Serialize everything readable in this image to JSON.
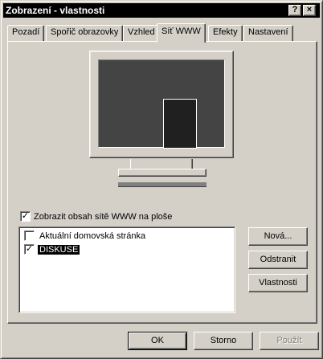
{
  "window": {
    "title": "Zobrazení - vlastnosti",
    "help_button": "?",
    "close_button": "×"
  },
  "tabs": [
    {
      "label": "Pozadí",
      "active": false
    },
    {
      "label": "Spořič obrazovky",
      "active": false
    },
    {
      "label": "Vzhled",
      "active": false
    },
    {
      "label": "Síť WWW",
      "active": true
    },
    {
      "label": "Efekty",
      "active": false
    },
    {
      "label": "Nastavení",
      "active": false
    }
  ],
  "web_tab": {
    "show_web_checkbox": {
      "label": "Zobrazit obsah sítě WWW na ploše",
      "checked": true,
      "mark": "✓"
    },
    "items": [
      {
        "label": "Aktuální domovská stránka",
        "checked": false,
        "mark": ""
      },
      {
        "label": "DISKUSE",
        "checked": true,
        "selected": true,
        "mark": "✓"
      }
    ],
    "buttons": {
      "new": "Nová...",
      "delete": "Odstranit",
      "properties": "Vlastnosti"
    }
  },
  "footer": {
    "ok": "OK",
    "cancel": "Storno",
    "apply": "Použít"
  },
  "colors": {
    "face": "#d4d0c8",
    "titlebar": "#000000",
    "screen": "#444444",
    "selection": "#000000"
  }
}
